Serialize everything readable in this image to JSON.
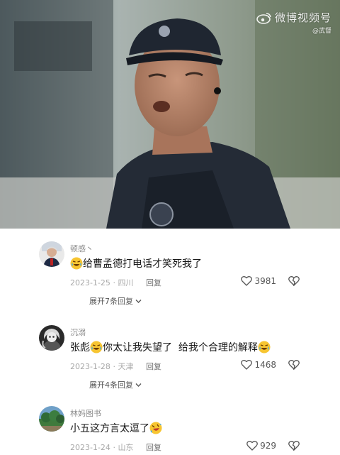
{
  "watermark": {
    "brand": "微博视频号",
    "handle": "@武督",
    "logo_icon": "weibo-logo-icon"
  },
  "comments": [
    {
      "username": "顿感丶",
      "text_before": "",
      "emoji": "laugh-cry-emoji",
      "text_after": "给曹孟德打电话才笑死我了",
      "date": "2023-1-25",
      "location": "四川",
      "reply_label": "回复",
      "likes": "3981",
      "expand_label": "展开7条回复"
    },
    {
      "username": "沉溺",
      "text_before": "张彪",
      "emoji": "laugh-cry-emoji",
      "text_after": "你太让我失望了  给我个合理的解释",
      "emoji_end": "laugh-cry-emoji",
      "date": "2023-1-28",
      "location": "天津",
      "reply_label": "回复",
      "likes": "1468",
      "expand_label": "展开4条回复"
    },
    {
      "username": "林妈图书",
      "text_before": "小五这方言太逗了",
      "emoji": "rofl-emoji",
      "text_after": "",
      "date": "2023-1-24",
      "location": "山东",
      "reply_label": "回复",
      "likes": "929"
    }
  ],
  "colors": {
    "username": "#8a8a8a",
    "body_text": "#161616",
    "meta": "#a8a8a8"
  }
}
